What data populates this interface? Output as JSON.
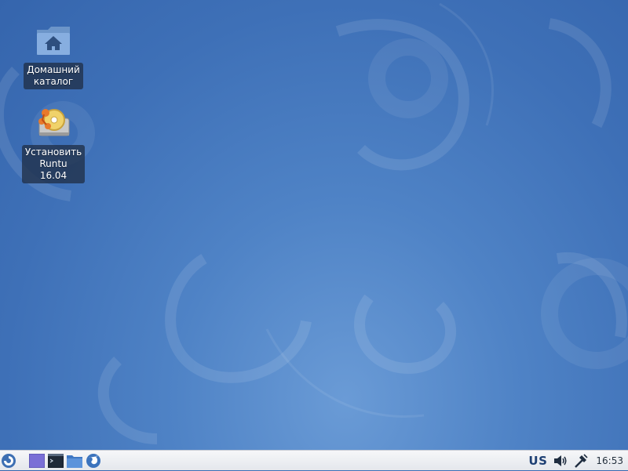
{
  "desktop": {
    "icons": [
      {
        "id": "home",
        "label": "Домашний\nкаталог",
        "icon": "home-folder-icon"
      },
      {
        "id": "install",
        "label": "Установить\nRuntu 16.04",
        "icon": "installer-icon"
      }
    ]
  },
  "panel": {
    "launchers": [
      {
        "icon": "menu-swirl-icon"
      },
      {
        "icon": "workspace-icon"
      },
      {
        "icon": "terminal-icon"
      },
      {
        "icon": "file-manager-icon"
      },
      {
        "icon": "web-browser-icon"
      }
    ],
    "tray": {
      "keyboard_layout": "US",
      "volume_icon": "volume-icon",
      "network_icon": "network-icon",
      "clock": "16:53"
    }
  },
  "colors": {
    "background": "#4a7dc2",
    "panel": "#eceef2",
    "label_bg": "#203048"
  }
}
